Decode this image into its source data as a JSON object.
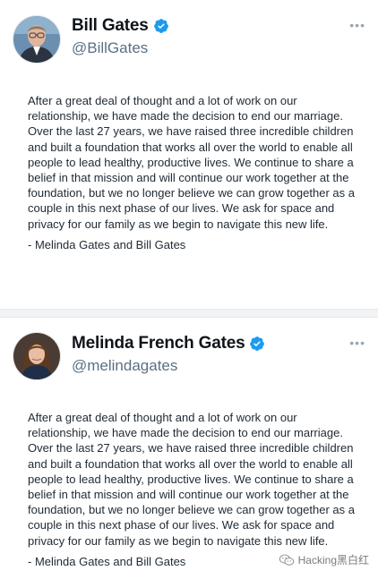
{
  "tweets": [
    {
      "display_name": "Bill Gates",
      "handle": "@BillGates",
      "more_icon": "more-dots-icon",
      "verified_icon": "verified-badge-icon",
      "paragraph": "After a great deal of thought and a lot of work on our relationship, we have made the decision to end our marriage. Over the last 27 years, we have raised three incredible children and built a foundation that works all over the world to enable all people to lead healthy, productive lives. We continue to share a belief in that mission and will continue our work together at the foundation, but we no longer believe we can grow together as a couple in this next phase of our lives. We ask for space and privacy for our family as we begin to navigate this new life.",
      "signature": "- Melinda Gates and Bill Gates"
    },
    {
      "display_name": "Melinda French Gates",
      "handle": "@melindagates",
      "more_icon": "more-dots-icon",
      "verified_icon": "verified-badge-icon",
      "paragraph": "After a great deal of thought and a lot of work on our relationship, we have made the decision to end our marriage. Over the last 27 years, we have raised three incredible children and built a foundation that works all over the world to enable all people to lead healthy, productive lives. We continue to share a belief in that mission and will continue our work together at the foundation, but we no longer believe we can grow together as a couple in this next phase of our lives. We ask for space and privacy for our family as we begin to navigate this new life.",
      "signature": "- Melinda Gates and Bill Gates"
    }
  ],
  "watermark": {
    "text": "Hacking黑白红",
    "icon": "wechat-icon"
  },
  "colors": {
    "verified": "#1d9bf0",
    "handle": "#5b7083",
    "text": "#1f2933"
  }
}
